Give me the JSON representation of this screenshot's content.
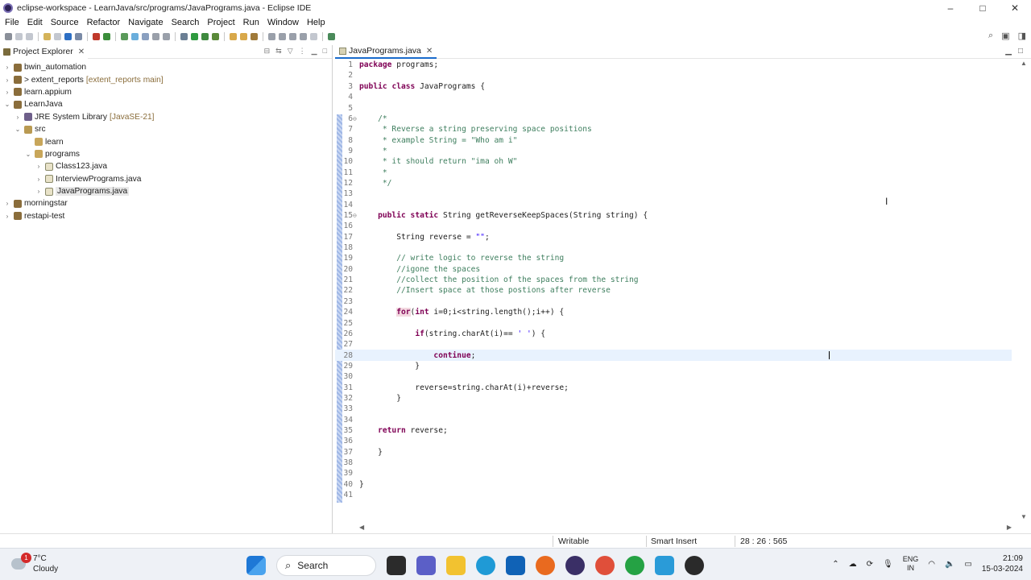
{
  "window": {
    "title": "eclipse-workspace - LearnJava/src/programs/JavaPrograms.java - Eclipse IDE",
    "controls": [
      "–",
      "□",
      "✕"
    ]
  },
  "menu": [
    "File",
    "Edit",
    "Source",
    "Refactor",
    "Navigate",
    "Search",
    "Project",
    "Run",
    "Window",
    "Help"
  ],
  "explorer": {
    "tab_label": "Project Explorer",
    "tree": [
      {
        "label": "bwin_automation",
        "deco": "",
        "toggle": "›",
        "icon": "proj"
      },
      {
        "label": "> extent_reports",
        "deco": "[extent_reports main]",
        "toggle": "›",
        "icon": "proj"
      },
      {
        "label": "learn.appium",
        "deco": "",
        "toggle": "›",
        "icon": "proj"
      },
      {
        "label": "LearnJava",
        "deco": "",
        "toggle": "⌄",
        "icon": "proj"
      },
      {
        "label": "JRE System Library",
        "deco": "[JavaSE-21]",
        "toggle": "›",
        "icon": "lib"
      },
      {
        "label": "src",
        "deco": "",
        "toggle": "⌄",
        "icon": "src"
      },
      {
        "label": "learn",
        "deco": "",
        "toggle": "",
        "icon": "pkg"
      },
      {
        "label": "programs",
        "deco": "",
        "toggle": "⌄",
        "icon": "pkg"
      },
      {
        "label": "Class123.java",
        "deco": "",
        "toggle": "›",
        "icon": "java"
      },
      {
        "label": "InterviewPrograms.java",
        "deco": "",
        "toggle": "›",
        "icon": "java"
      },
      {
        "label": "JavaPrograms.java",
        "deco": "",
        "toggle": "›",
        "icon": "java"
      },
      {
        "label": "morningstar",
        "deco": "",
        "toggle": "›",
        "icon": "proj"
      },
      {
        "label": "restapi-test",
        "deco": "",
        "toggle": "›",
        "icon": "proj"
      }
    ]
  },
  "editor": {
    "tab_label": "JavaPrograms.java",
    "lines": [
      {
        "n": "1",
        "html": "<span class='kw'>package</span> programs;"
      },
      {
        "n": "2",
        "html": ""
      },
      {
        "n": "3",
        "html": "<span class='kw'>public</span> <span class='kw'>class</span> JavaPrograms {"
      },
      {
        "n": "4",
        "html": ""
      },
      {
        "n": "5",
        "html": ""
      },
      {
        "n": "6",
        "html": "    <span class='cm'>/*</span>",
        "fold": "⊖"
      },
      {
        "n": "7",
        "html": "<span class='cm'>     * Reverse a string preserving space positions</span>"
      },
      {
        "n": "8",
        "html": "<span class='cm'>     * example String = \"Who am i\"</span>"
      },
      {
        "n": "9",
        "html": "<span class='cm'>     *</span>"
      },
      {
        "n": "10",
        "html": "<span class='cm'>     * it should return \"ima oh W\"</span>"
      },
      {
        "n": "11",
        "html": "<span class='cm'>     *</span>"
      },
      {
        "n": "12",
        "html": "<span class='cm'>     */</span>"
      },
      {
        "n": "13",
        "html": ""
      },
      {
        "n": "14",
        "html": ""
      },
      {
        "n": "15",
        "html": "    <span class='kw'>public</span> <span class='kw'>static</span> String getReverseKeepSpaces(String string) {",
        "fold": "⊖"
      },
      {
        "n": "16",
        "html": ""
      },
      {
        "n": "17",
        "html": "        String reverse = <span class='st'>\"\"</span>;"
      },
      {
        "n": "18",
        "html": ""
      },
      {
        "n": "19",
        "html": "<span class='cm'>        // write logic to reverse the string</span>"
      },
      {
        "n": "20",
        "html": "<span class='cm'>        //igone the spaces</span>"
      },
      {
        "n": "21",
        "html": "<span class='cm'>        //collect the position of the spaces from the string</span>"
      },
      {
        "n": "22",
        "html": "<span class='cm'>        //Insert space at those postions after reverse</span>"
      },
      {
        "n": "23",
        "html": ""
      },
      {
        "n": "24",
        "html": "        <span class='kw kwbg'>for</span>(<span class='kw'>int</span> i=0;i&lt;string.length();i++) {"
      },
      {
        "n": "25",
        "html": ""
      },
      {
        "n": "26",
        "html": "            <span class='kw'>if</span>(string.charAt(i)== <span class='st'>' '</span>) {"
      },
      {
        "n": "27",
        "html": ""
      },
      {
        "n": "28",
        "html": "                <span class='kw'>continue</span>;",
        "current": true
      },
      {
        "n": "29",
        "html": "            }"
      },
      {
        "n": "30",
        "html": ""
      },
      {
        "n": "31",
        "html": "            reverse=string.charAt(i)+reverse;"
      },
      {
        "n": "32",
        "html": "        }"
      },
      {
        "n": "33",
        "html": ""
      },
      {
        "n": "34",
        "html": ""
      },
      {
        "n": "35",
        "html": "    <span class='kw'>return</span> reverse;"
      },
      {
        "n": "36",
        "html": ""
      },
      {
        "n": "37",
        "html": "    }"
      },
      {
        "n": "38",
        "html": ""
      },
      {
        "n": "39",
        "html": ""
      },
      {
        "n": "40",
        "html": "}"
      },
      {
        "n": "41",
        "html": ""
      }
    ]
  },
  "status": {
    "mode": "Writable",
    "insert": "Smart Insert",
    "position": "28 : 26 : 565"
  },
  "taskbar": {
    "weather_temp": "7°C",
    "weather_desc": "Cloudy",
    "weather_badge": "1",
    "search_label": "Search",
    "lang_top": "ENG",
    "lang_bottom": "IN",
    "time": "21:09",
    "date": "15-03-2024"
  }
}
